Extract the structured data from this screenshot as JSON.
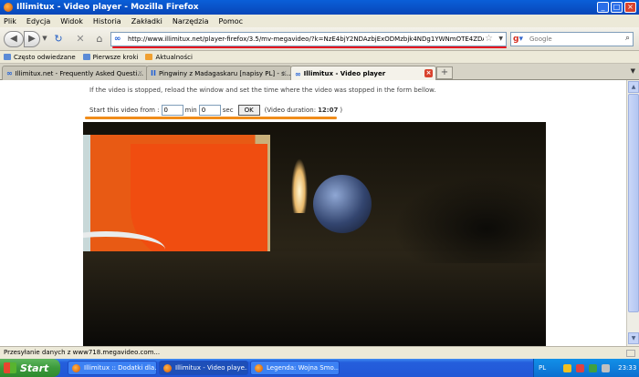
{
  "window": {
    "title": "Illimitux - Video player - Mozilla Firefox"
  },
  "menu": [
    "Plik",
    "Edycja",
    "Widok",
    "Historia",
    "Zakładki",
    "Narzędzia",
    "Pomoc"
  ],
  "nav": {
    "url": "http://www.illimitux.net/player-firefox/3.5/mv-megavideo/?k=NzE4bjY2NDAzbjExODMzbjk4NDg1YWNmOTE4ZDA5M2NlZWQ5Y",
    "search_placeholder": "Google",
    "search_engine_letter": "g"
  },
  "bookmarks": [
    "Często odwiedzane",
    "Pierwsze kroki",
    "Aktualności"
  ],
  "tabs": [
    {
      "label": "Illimitux.net - Frequently Asked Questi...",
      "icon": "∞"
    },
    {
      "label": "Pingwiny z Madagaskaru [napisy PL] - s...",
      "icon": "II"
    },
    {
      "label": "Illimitux - Video player",
      "icon": "∞"
    }
  ],
  "page": {
    "info": "If the video is stopped, reload the window and set the time where the video was stopped in the form bellow.",
    "form": {
      "start_label": "Start this video from :",
      "min_value": "0",
      "min_label": "min",
      "sec_value": "0",
      "sec_label": "sec",
      "ok_label": "OK",
      "duration_prefix": "(Video duration:",
      "duration_value": "12:07",
      "duration_suffix": ")"
    }
  },
  "status": {
    "text": "Przesyłanie danych z www718.megavideo.com..."
  },
  "taskbar": {
    "start": "Start",
    "tasks": [
      "Illimitux :: Dodatki dla...",
      "Illimitux - Video playe...",
      "Legenda: Wojna Smo..."
    ],
    "lang": "PL",
    "clock": "23:33"
  },
  "colors": {
    "accent_red": "#e8161f",
    "accent_orange": "#f08c1a"
  }
}
